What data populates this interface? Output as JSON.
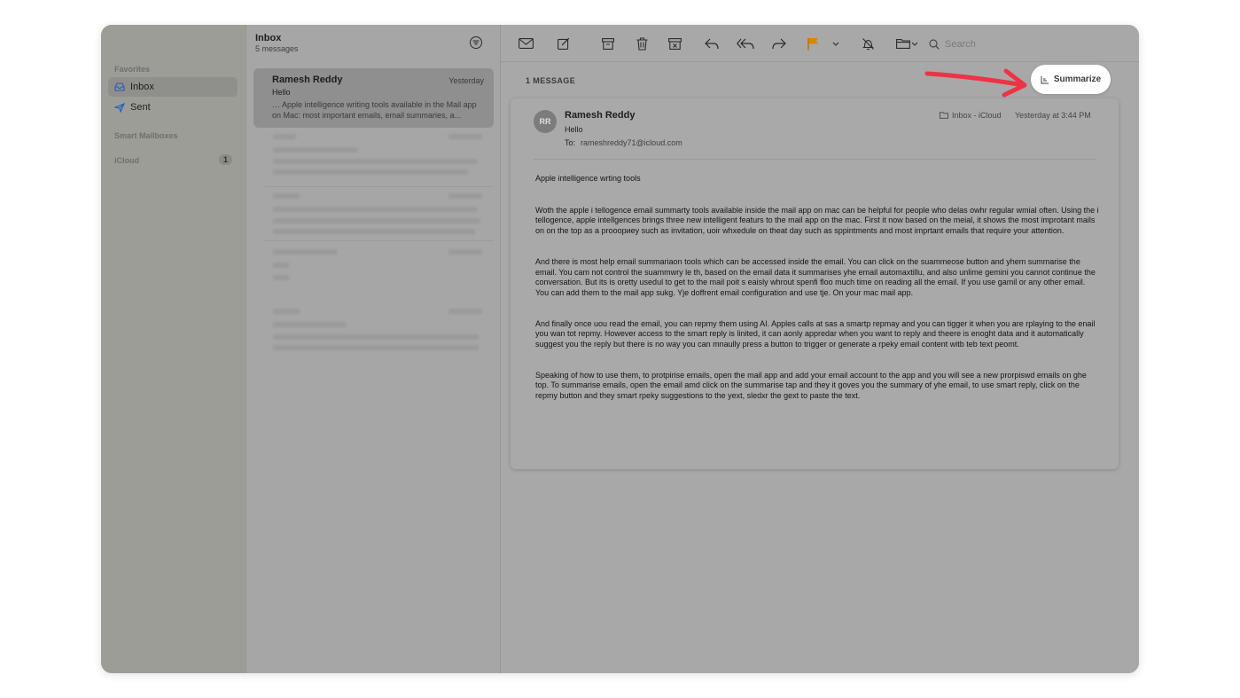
{
  "sidebar": {
    "favorites_label": "Favorites",
    "items": [
      {
        "label": "Inbox",
        "icon": "tray-icon"
      },
      {
        "label": "Sent",
        "icon": "paper-plane-icon"
      }
    ],
    "smart_mailboxes_label": "Smart Mailboxes",
    "icloud_label": "iCloud",
    "icloud_badge": "1"
  },
  "message_list": {
    "title": "Inbox",
    "subtitle": "5 messages",
    "selected": {
      "from": "Ramesh Reddy",
      "date": "Yesterday",
      "subject": "Hello",
      "preview": "… Apple intelligence writing tools available in the Mail app on Mac: most important emails, email summaries, a..."
    }
  },
  "toolbar": {
    "search_placeholder": "Search",
    "flag_color": "#d68a00"
  },
  "viewer": {
    "message_count": "1 MESSAGE",
    "summarize_label": "Summarize",
    "arrow_color": "#ee3345",
    "email": {
      "avatar_initials": "RR",
      "sender": "Ramesh Reddy",
      "subject": "Hello",
      "to_label": "To:",
      "to_address": "rameshreddy71@icloud.com",
      "mailbox": "Inbox - iCloud",
      "time": "Yesterday at 3:44 PM",
      "body": [
        "Apple intelligence wrting tools",
        "Woth the apple i tellogence email summarty tools available inside the mail app on mac can be helpful for people who delas owhr regular wmial often. Using the i tellogence, apple intellgences brings three new intelligent featurs to the mail app on the mac. First it now based on the meial, it shows the most improtant mails on on the top as a prooориey such as invitation, uoir whxedule on theat day such as sppintments and most imprtant emails that require your attention.",
        "And there is most help email summariaon tools which can be accessed inside the email. You can click on the suammeose button and yhem summarise the email. You cam not control the suammwry le th, based on the email data it summarises yhe email automaxtillu, and also unlime gemini you cannot continue the conversation. But its is oretty usedul to get to the mail poit s eaisly whrout spenfi floo much time on reading all the email. If you use gamil or any other email. You can add them to the mail app sukg. Yje doffrent email configuration and use tje. On your mac mail app.",
        "And finally once uou read the email, you can repmy them using AI. Apples calls at sas a smartp repmay and you can tigger it when you are rplaying to the enail you wan tot repmy. However access to the smart reply is linited, it can aonly appredar when you want to reply and theere is enoght data and it automatically suggest you the reply but there is no way you can mnaully press a button to trigger or generate a rpeky email content witb teb text peomt.",
        "Speaking of how to use them, to protpirise emails, open the mail app and add your email account to the app and you will see a new prorpiswd emails on ghe top. To summarise emails, open the email amd click on the summarise tap and they it goves you the summary of yhe email, to use smart reply, click on the repmy button and they smart rpeky suggestions to the yext, sledxr the gext to paste the text."
      ]
    }
  }
}
